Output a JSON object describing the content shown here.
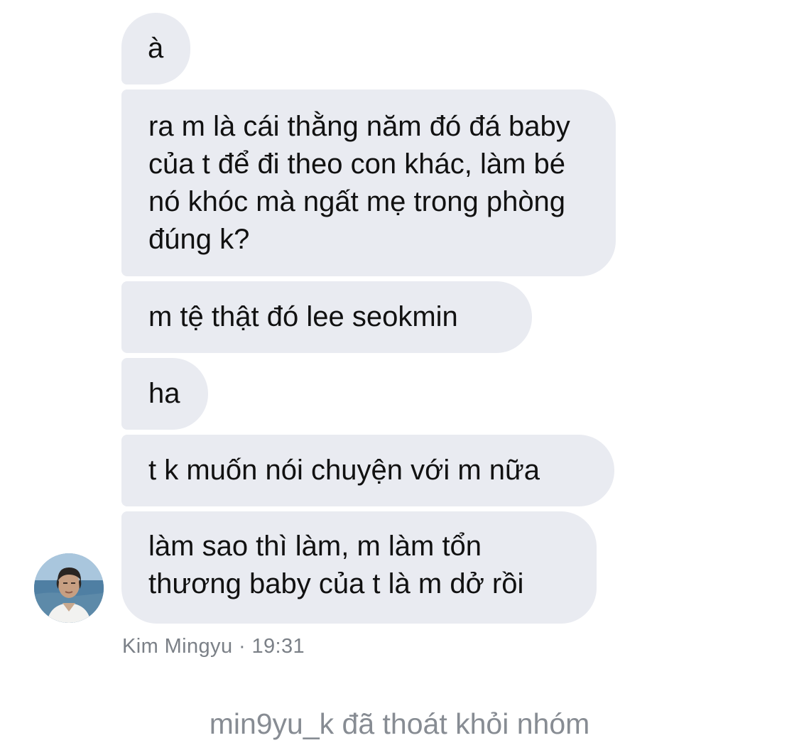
{
  "messages": [
    {
      "text": "à"
    },
    {
      "text": "ra m là cái thằng năm đó đá baby của t để đi theo con khác, làm bé nó khóc mà ngất mẹ trong phòng đúng k?"
    },
    {
      "text": "m tệ thật đó lee seokmin"
    },
    {
      "text": "ha"
    },
    {
      "text": "t k muốn nói chuyện với m nữa"
    },
    {
      "text": "làm sao thì làm, m làm tổn thương baby của t là m dở rồi"
    }
  ],
  "sender": {
    "name_time": "Kim Mingyu · 19:31",
    "avatar_icon": "profile-photo"
  },
  "system_note": "min9yu_k đã thoát khỏi nhóm",
  "colors": {
    "bubble_bg": "#e9ebf1",
    "meta_text": "#7b8087",
    "system_text": "#878c93"
  }
}
